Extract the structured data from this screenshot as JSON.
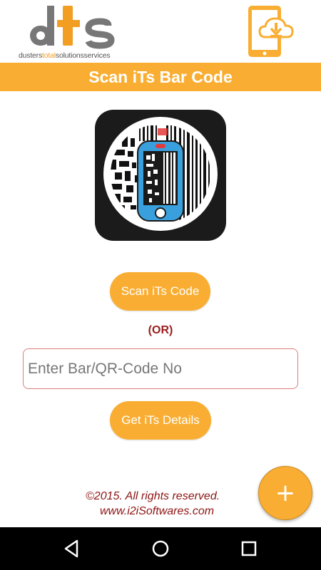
{
  "header": {
    "logo_letters": "dts",
    "logo_text_pre": "dusters",
    "logo_text_accent": "total",
    "logo_text_post": "solutionsservices",
    "download_icon": "tablet-download-icon"
  },
  "title": "Scan iTs Bar Code",
  "app_icon": "barcode-scanner-icon",
  "buttons": {
    "scan": "Scan iTs Code",
    "or": "(OR)",
    "details": "Get iTs Details"
  },
  "input": {
    "placeholder": "Enter Bar/QR-Code No",
    "value": ""
  },
  "footer": {
    "copyright": "©2015. All rights reserved.",
    "website": "www.i2iSoftwares.com"
  },
  "fab": {
    "label": "+",
    "icon": "plus-icon"
  },
  "navbar": {
    "back": "back-icon",
    "home": "home-icon",
    "recents": "recents-icon"
  },
  "colors": {
    "accent": "#f9ae33",
    "footer_text": "#8e1414",
    "or_text": "#9b1c1c",
    "input_border": "#e07b7b",
    "icon_blue": "#3aa0dd"
  }
}
